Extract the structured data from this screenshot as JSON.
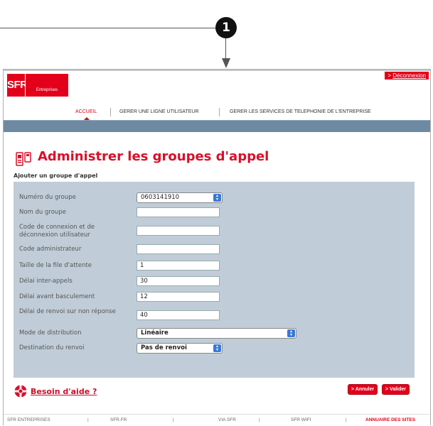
{
  "callout": {
    "number": "1"
  },
  "header": {
    "logo_brand": "SFR",
    "logo_sub": "Entreprises",
    "logout_prefix": "> ",
    "logout_label": "Déconnexion"
  },
  "nav": {
    "items": [
      {
        "label": "ACCUEIL",
        "active": true
      },
      {
        "label": "GERER UNE LIGNE UTILISATEUR",
        "active": false
      },
      {
        "label": "GERER LES SERVICES DE TELEPHONIE DE L'ENTREPRISE",
        "active": false
      }
    ]
  },
  "page": {
    "title": "Administrer les groupes d'appel",
    "subtitle": "Ajouter un groupe d'appel"
  },
  "form": {
    "fields": [
      {
        "label": "Numéro du groupe",
        "type": "select",
        "value": "0603141910"
      },
      {
        "label": "Nom du groupe",
        "type": "text",
        "value": ""
      },
      {
        "label": "Code de connexion et de déconnexion utilisateur",
        "type": "text",
        "value": ""
      },
      {
        "label": "Code administrateur",
        "type": "text",
        "value": ""
      },
      {
        "label": "Taille de la file d'attente",
        "type": "text",
        "value": "1"
      },
      {
        "label": "Délai inter-appels",
        "type": "text",
        "value": "30"
      },
      {
        "label": "Délai avant basculement",
        "type": "text",
        "value": "12"
      },
      {
        "label": "Délai de renvoi sur non réponse",
        "type": "text",
        "value": "40"
      },
      {
        "label": "Mode de distribution",
        "type": "select",
        "value": "Linéaire"
      },
      {
        "label": "Destination du renvoi",
        "type": "select",
        "value": "Pas de renvoi"
      }
    ]
  },
  "help": {
    "label": "Besoin d'aide ?"
  },
  "buttons": {
    "cancel": "> Annuler",
    "submit": "> Valider"
  },
  "footer": {
    "links": [
      "SFR ENTREPRISES",
      "SFR.FR",
      "VIA SFR",
      "SFR WIFI",
      "ANNUAIRE DES SITES"
    ],
    "separator": "|"
  },
  "colors": {
    "brand_red": "#e2001a",
    "panel_blue": "#c0cdd8",
    "nav_bar": "#6d8aa2"
  }
}
